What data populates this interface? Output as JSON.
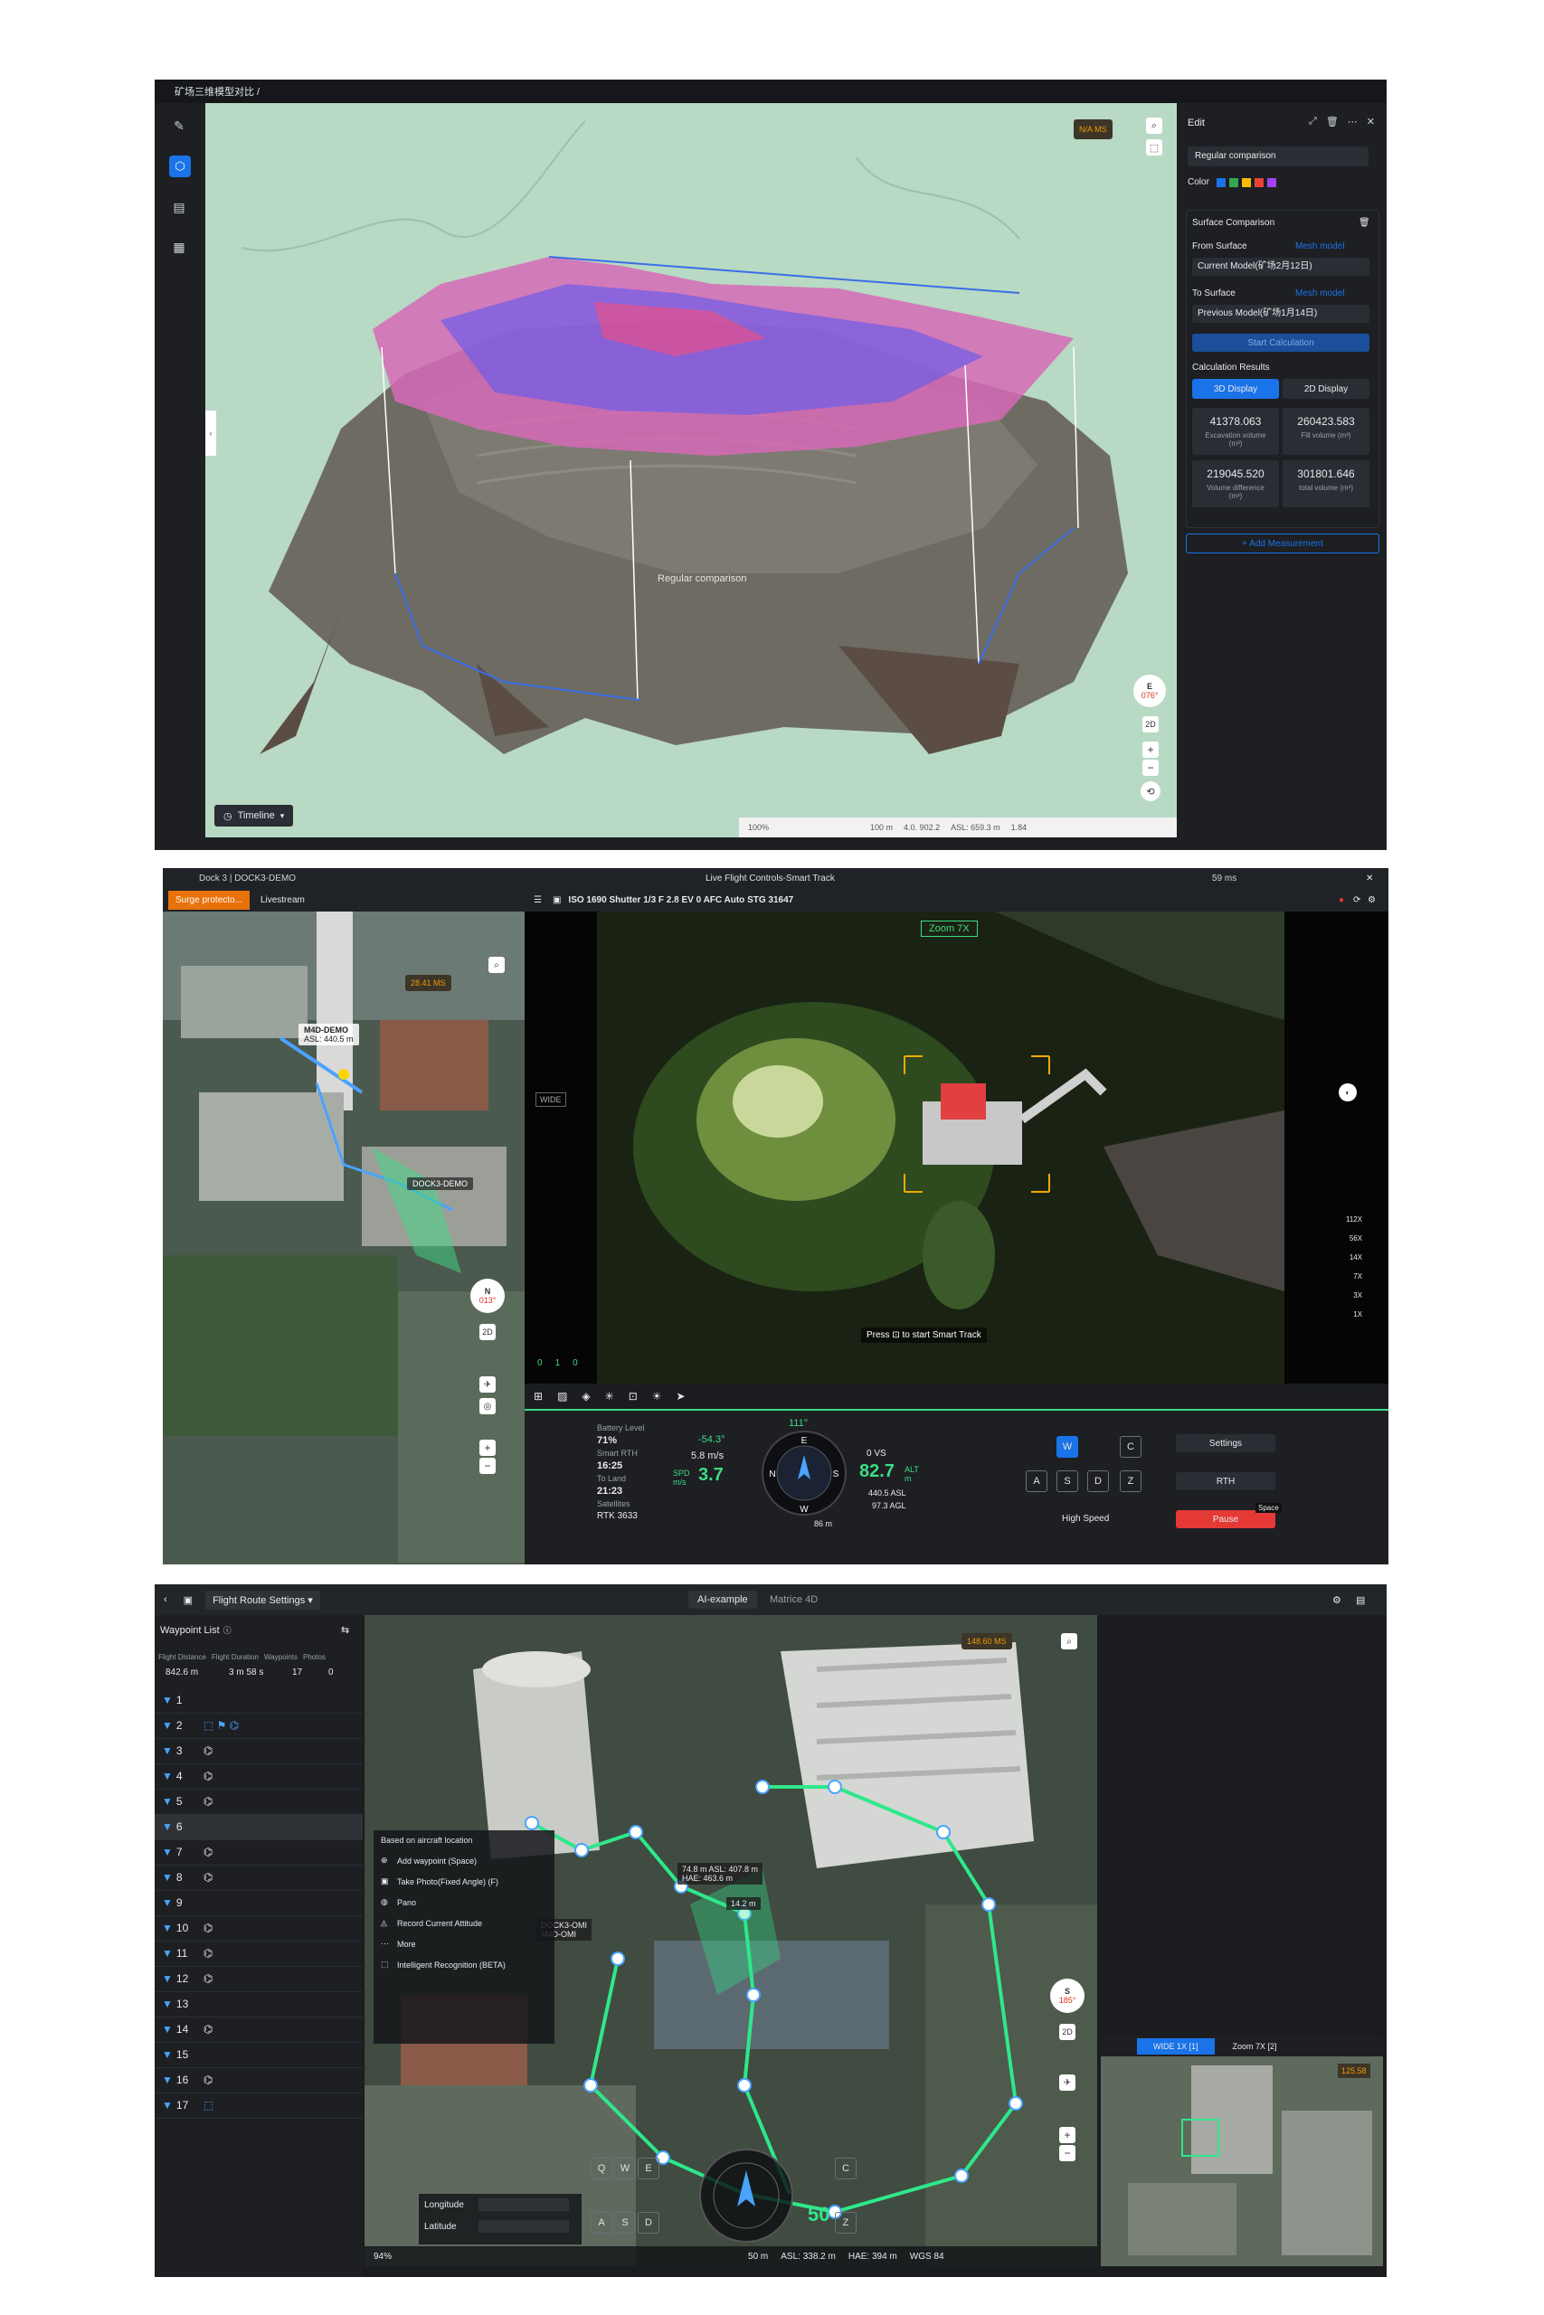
{
  "panel1": {
    "breadcrumb": "矿场三维模型对比 /",
    "right_panel": {
      "edit_label": "Edit",
      "name_value": "Regular comparison",
      "color_label": "Color",
      "colors": [
        "#1a73e8",
        "#34a853",
        "#fbbc04",
        "#ea4335",
        "#a142f4"
      ],
      "surface_comparison_title": "Surface Comparison",
      "from_surface_label": "From Surface",
      "from_surface_type": "Mesh model",
      "from_surface_value": "Current Model(矿场2月12日)",
      "to_surface_label": "To Surface",
      "to_surface_type": "Mesh model",
      "to_surface_value": "Previous Model(矿场1月14日)",
      "start_calc_label": "Start Calculation",
      "results_label": "Calculation Results",
      "tab_3d": "3D Display",
      "tab_2d": "2D Display",
      "metrics": [
        {
          "value": "41378.063",
          "label": "Excavation volume (m³)"
        },
        {
          "value": "260423.583",
          "label": "Fill volume (m³)"
        },
        {
          "value": "219045.520",
          "label": "Volume difference (m³)"
        },
        {
          "value": "301801.646",
          "label": "total volume (m³)"
        }
      ],
      "add_measurement": "+ Add Measurement"
    },
    "compass_label": "E",
    "compass_deg": "076°",
    "btn_2d": "2D",
    "zoom_plus": "+",
    "zoom_minus": "−",
    "timeline_label": "Timeline",
    "status_zoom": "100%",
    "status_scale": "100 m",
    "status_coords": "4.0. 902.2",
    "status_asl": "ASL: 659.3 m",
    "status_extra": "1.84",
    "region_label": "Regular comparison",
    "speed_badge": "N/A MS"
  },
  "panel2": {
    "title_left": "Dock 3 | DOCK3-DEMO",
    "title_center": "Live Flight Controls-Smart Track",
    "title_right": "59 ms",
    "tab_surge": "Surge protecto...",
    "tab_livestream": "Livestream",
    "camera_info": "ISO 1690   Shutter 1/3   F 2.8   EV 0   AFC   Auto   STG 31647",
    "zoom_badge": "Zoom 7X",
    "smart_track_hint": "Press ⊡ to start Smart Track",
    "map_speed": "28.41 MS",
    "map_label_m4d": "M4D-DEMO",
    "map_label_m4d_asl": "ASL: 440.5 m",
    "map_label_dock": "DOCK3-DEMO",
    "compass_n": "N",
    "compass_deg": "013°",
    "btn_2d": "2D",
    "zoom_levels": [
      "112X",
      "56X",
      "14X",
      "7X",
      "3X",
      "1X"
    ],
    "counts": [
      "0",
      "1",
      "0"
    ],
    "battery_label": "Battery Level",
    "battery_value": "71%",
    "smart_rth_label": "Smart RTH",
    "smart_rth_value": "16:25",
    "to_land_label": "To Land",
    "to_land_value": "21:23",
    "satellites_label": "Satellites",
    "satellites_value": "RTK 3633",
    "heading": "111°",
    "pitch": "-54.3°",
    "hspeed": "5.8 m/s",
    "spd_label": "SPD m/s",
    "spd_value": "3.7",
    "vs_value": "0 VS",
    "alt_value": "82.7",
    "alt_label": "ALT m",
    "asl_value": "440.5 ASL",
    "agl_value": "97.3 AGL",
    "dist_value": "86 m",
    "keys": [
      "W",
      "A",
      "S",
      "D",
      "C",
      "Z"
    ],
    "high_speed": "High Speed",
    "settings_btn": "Settings",
    "rth_btn": "RTH",
    "pause_btn": "Pause",
    "space_hint": "Space",
    "wide_label": "WIDE"
  },
  "panel3": {
    "flight_route_settings": "Flight Route Settings",
    "tab_ai": "AI-example",
    "tab_matrice": "Matrice 4D",
    "waypoint_list": "Waypoint List",
    "stats_headers": [
      "Flight Distance",
      "Flight Duration",
      "Waypoints",
      "Photos"
    ],
    "stats_values": [
      "842.6 m",
      "3 m 58 s",
      "17",
      "0"
    ],
    "waypoints": [
      "1",
      "2",
      "3",
      "4",
      "5",
      "6",
      "7",
      "8",
      "9",
      "10",
      "11",
      "12",
      "13",
      "14",
      "15",
      "16",
      "17"
    ],
    "context_menu": {
      "title": "Based on aircraft location",
      "items": [
        "Add waypoint (Space)",
        "Take Photo(Fixed Angle) (F)",
        "Pano",
        "Record Current Attitude",
        "More",
        "Intelligent Recognition (BETA)"
      ]
    },
    "map_speed": "148.60 MS",
    "waypoint_info_1": "74.8 m  ASL: 407.8 m",
    "waypoint_info_2": "HAE: 463.6 m",
    "seg_distance": "14.2 m",
    "dock_label": "DOCK3-OMI",
    "m4d_label": "M4D-OMI",
    "compass_s": "S",
    "compass_deg": "185°",
    "btn_2d": "2D",
    "longitude_label": "Longitude",
    "latitude_label": "Latitude",
    "keys": [
      "Q",
      "W",
      "E",
      "A",
      "S",
      "D",
      "C",
      "Z"
    ],
    "alt_overlay": "50",
    "status_zoom": "94%",
    "status_scale": "50 m",
    "status_asl": "ASL: 338.2 m",
    "status_hae": "HAE: 394 m",
    "status_wgs": "WGS 84",
    "pip_tab_wide": "WIDE 1X [1]",
    "pip_tab_zoom": "Zoom 7X [2]",
    "pip_speed": "125.58"
  }
}
